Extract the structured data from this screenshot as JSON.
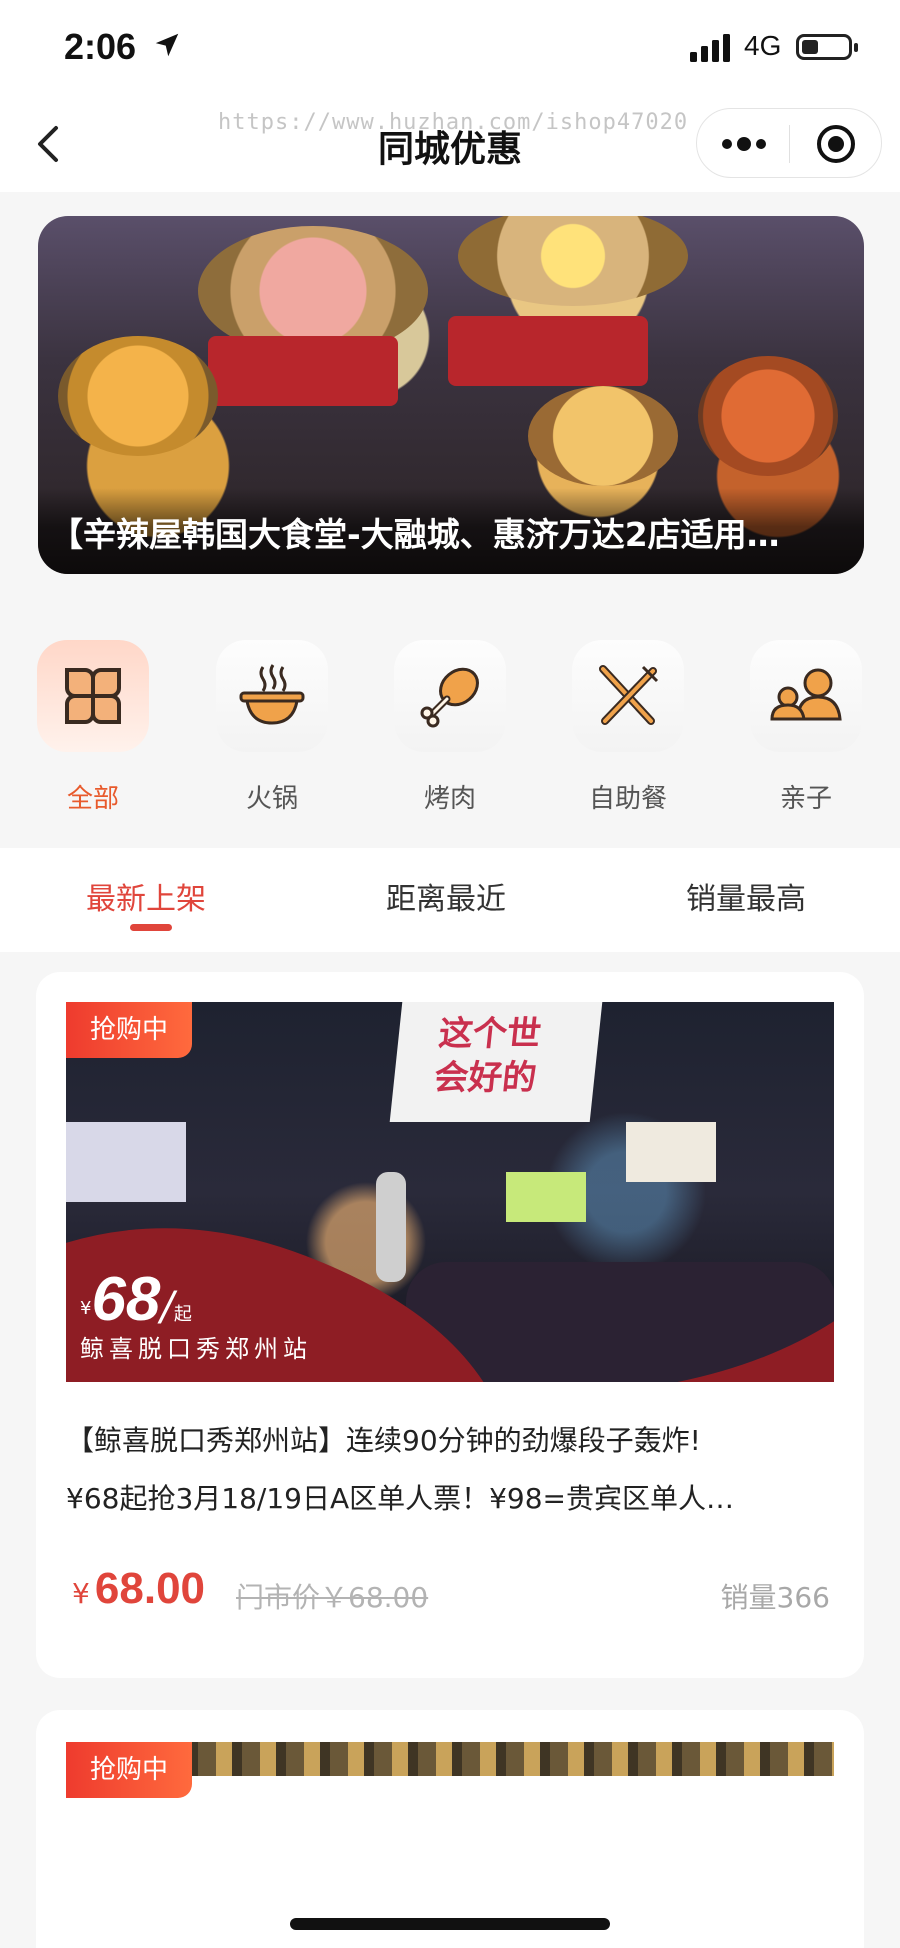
{
  "status_bar": {
    "time": "2:06",
    "network": "4G"
  },
  "nav": {
    "title": "同城优惠",
    "watermark": "https://www.huzhan.com/ishop47020"
  },
  "banner": {
    "caption": "【辛辣屋韩国大食堂-大融城、惠济万达2店适用…"
  },
  "categories": [
    {
      "label": "全部",
      "icon": "clover-grid-icon",
      "active": true
    },
    {
      "label": "火锅",
      "icon": "hotpot-icon",
      "active": false
    },
    {
      "label": "烤肉",
      "icon": "drumstick-icon",
      "active": false
    },
    {
      "label": "自助餐",
      "icon": "knife-fork-icon",
      "active": false
    },
    {
      "label": "亲子",
      "icon": "parent-child-icon",
      "active": false
    }
  ],
  "tabs": [
    {
      "label": "最新上架",
      "active": true
    },
    {
      "label": "距离最近",
      "active": false
    },
    {
      "label": "销量最高",
      "active": false
    }
  ],
  "products": [
    {
      "badge": "抢购中",
      "overlay_yen": "¥",
      "overlay_price": "68",
      "overlay_slash": "/",
      "overlay_qi": "起",
      "overlay_venue": "鲸喜脱口秀郑州站",
      "image_sign": "这个世\n会好的",
      "title_line1": "【鲸喜脱口秀郑州站】连续90分钟的劲爆段子轰炸!",
      "title_line2": "¥68起抢3月18/19日A区单人票！¥98=贵宾区单人…",
      "price_symbol": "¥",
      "price": "68.00",
      "original_price": "门市价￥68.00",
      "sales": "销量366"
    },
    {
      "badge": "抢购中"
    }
  ],
  "colors": {
    "accent": "#e0453b",
    "category_active": "#e85a2c",
    "badge_start": "#ee3b2e",
    "badge_end": "#ff6a3d"
  }
}
